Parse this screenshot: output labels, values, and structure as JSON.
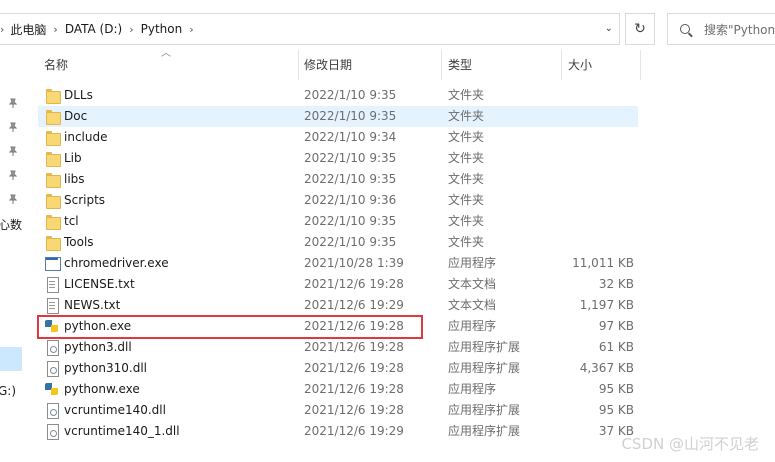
{
  "address_bar": {
    "crumbs": [
      "此电脑",
      "DATA (D:)",
      "Python"
    ]
  },
  "search": {
    "placeholder": "搜索\"Python\""
  },
  "nav_fragments": [
    "心数",
    "G:)"
  ],
  "columns": {
    "name": "名称",
    "date": "修改日期",
    "type": "类型",
    "size": "大小"
  },
  "files": [
    {
      "name": "DLLs",
      "date": "2022/1/10 9:35",
      "type": "文件夹",
      "size": "",
      "icon": "folder-icon"
    },
    {
      "name": "Doc",
      "date": "2022/1/10 9:35",
      "type": "文件夹",
      "size": "",
      "icon": "folder-icon"
    },
    {
      "name": "include",
      "date": "2022/1/10 9:34",
      "type": "文件夹",
      "size": "",
      "icon": "folder-icon"
    },
    {
      "name": "Lib",
      "date": "2022/1/10 9:35",
      "type": "文件夹",
      "size": "",
      "icon": "folder-icon"
    },
    {
      "name": "libs",
      "date": "2022/1/10 9:35",
      "type": "文件夹",
      "size": "",
      "icon": "folder-icon"
    },
    {
      "name": "Scripts",
      "date": "2022/1/10 9:36",
      "type": "文件夹",
      "size": "",
      "icon": "folder-icon"
    },
    {
      "name": "tcl",
      "date": "2022/1/10 9:35",
      "type": "文件夹",
      "size": "",
      "icon": "folder-icon"
    },
    {
      "name": "Tools",
      "date": "2022/1/10 9:35",
      "type": "文件夹",
      "size": "",
      "icon": "folder-icon"
    },
    {
      "name": "chromedriver.exe",
      "date": "2021/10/28 1:39",
      "type": "应用程序",
      "size": "11,011 KB",
      "icon": "exe-icon"
    },
    {
      "name": "LICENSE.txt",
      "date": "2021/12/6 19:28",
      "type": "文本文档",
      "size": "32 KB",
      "icon": "text-file-icon"
    },
    {
      "name": "NEWS.txt",
      "date": "2021/12/6 19:29",
      "type": "文本文档",
      "size": "1,197 KB",
      "icon": "text-file-icon"
    },
    {
      "name": "python.exe",
      "date": "2021/12/6 19:28",
      "type": "应用程序",
      "size": "97 KB",
      "icon": "python-icon"
    },
    {
      "name": "python3.dll",
      "date": "2021/12/6 19:28",
      "type": "应用程序扩展",
      "size": "61 KB",
      "icon": "dll-icon"
    },
    {
      "name": "python310.dll",
      "date": "2021/12/6 19:28",
      "type": "应用程序扩展",
      "size": "4,367 KB",
      "icon": "dll-icon"
    },
    {
      "name": "pythonw.exe",
      "date": "2021/12/6 19:28",
      "type": "应用程序",
      "size": "95 KB",
      "icon": "python-icon"
    },
    {
      "name": "vcruntime140.dll",
      "date": "2021/12/6 19:28",
      "type": "应用程序扩展",
      "size": "95 KB",
      "icon": "dll-icon"
    },
    {
      "name": "vcruntime140_1.dll",
      "date": "2021/12/6 19:29",
      "type": "应用程序扩展",
      "size": "37 KB",
      "icon": "dll-icon"
    }
  ],
  "selected_row": "Doc",
  "highlighted_row": "python.exe",
  "colors": {
    "selection": "#e5f3ff",
    "highlight_border": "#e0383e",
    "folder": "#f8d775"
  },
  "watermark": "CSDN @山河不见老"
}
